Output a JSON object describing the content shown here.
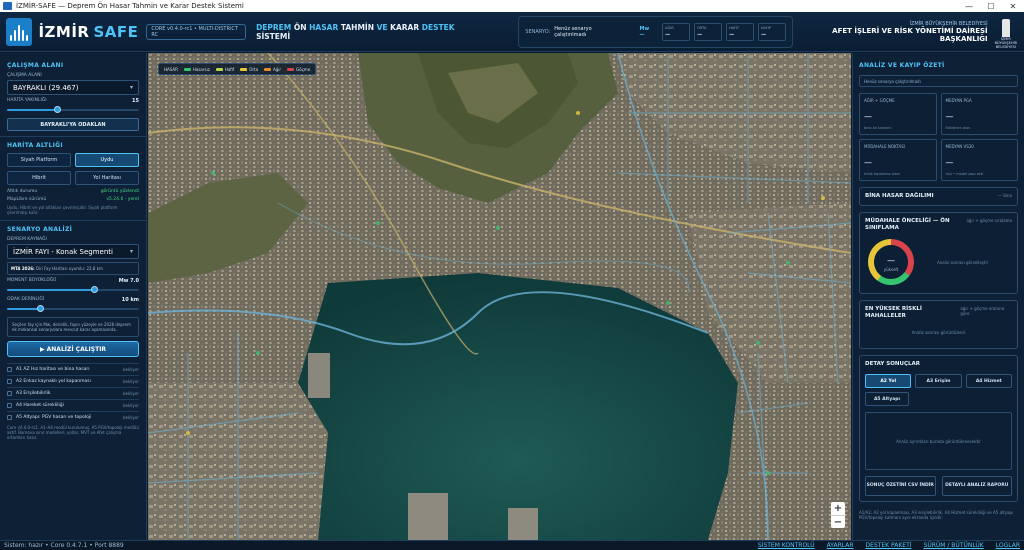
{
  "window": {
    "title": "İZMİR-SAFE — Deprem Ön Hasar Tahmin ve Karar Destek Sistemi",
    "minimize": "—",
    "maximize": "☐",
    "close": "✕"
  },
  "header": {
    "brand": "İZMİR",
    "brand_accent": "SAFE",
    "version_badge": "CORE v0.4.0-rc1 • MULTI-DISTRICT RC",
    "title_parts": [
      "DEPREM ",
      "ÖN ",
      "HASAR ",
      "TAHMİN ",
      "VE ",
      "KARAR ",
      "DESTEK ",
      "SİSTEMİ"
    ],
    "scenario_label": "SENARYO:",
    "scenario_value": "Henüz senaryo çalıştırılmadı",
    "mw_label": "Mw —",
    "chips": [
      {
        "label": "AĞIR",
        "value": "—"
      },
      {
        "label": "ORTA",
        "value": "—"
      },
      {
        "label": "HAFİF",
        "value": "—"
      },
      {
        "label": "KAYIP",
        "value": "—"
      }
    ],
    "org_line1": "İZMİR BÜYÜKŞEHİR BELEDİYESİ",
    "org_line2": "AFET İŞLERİ VE RİSK YÖNETİMİ DAİRESİ BAŞKANLIĞI",
    "emblem_text": "İZMİR BÜYÜKŞEHİR BELEDİYESİ"
  },
  "left": {
    "work_area_title": "ÇALIŞMA ALANI",
    "work_area_label": "ÇALIŞMA ALANI",
    "work_area_value": "BAYRAKLI (29.467)",
    "zoom_label": "HARİTA YAKINLIĞI",
    "zoom_value": "15",
    "zoom_fraction": 0.38,
    "focus_button": "BAYRAKLI'YA ODAKLAN",
    "map_layer_title": "HARİTA ALTLIĞI",
    "layer_buttons": [
      "Siyah Platform",
      "Uydu",
      "Hibrit",
      "Yol Haritası"
    ],
    "active_layer": "Uydu",
    "kv": [
      {
        "k": "Altlık durumu",
        "v": "görüntü yüklendi",
        "green": true
      },
      {
        "k": "MapLibre sürümü",
        "v": "v5.24.0 - yerel",
        "green": true
      }
    ],
    "layer_note": "Uydu, Hibrit ve yol altlıkları çevrimiçidir. Siyah platform çevrimdışı kalır.",
    "scenario_title": "SENARYO ANALİZİ",
    "fault_label": "DEPREM KAYNAĞI",
    "fault_value": "İZMİR FAYI - Konak Segmenti",
    "mta_label": "MTA 2026:",
    "mta_text": "Diri Fay Haritası uyumlu: 22,8 km",
    "magnitude_label": "MOMENT BÜYÜKLÜĞÜ",
    "magnitude_value": "Mw 7.0",
    "magnitude_fraction": 0.66,
    "depth_label": "ODAK DERİNLİĞİ",
    "depth_value": "10 km",
    "depth_fraction": 0.25,
    "info_text": "Seçilen fay için Mw, derinlik, fayın yüzeyle ve 2026 deprem ek mekansal senaryolara mevcut karar aşamasında.",
    "run_button": "▶ ANALİZİ ÇALIŞTIR",
    "analysis_items": [
      {
        "label": "A1 AZ Hız haritası ve bina hasarı",
        "status": "bekliyor"
      },
      {
        "label": "A2 Enkaz kaynaklı yol kapanması",
        "status": "bekliyor"
      },
      {
        "label": "A3 Erişilebilirlik",
        "status": "bekliyor"
      },
      {
        "label": "A4 Hareket sürekliliği",
        "status": "bekliyor"
      },
      {
        "label": "A5 Altyapı: PGV hasarı ve topoloji",
        "status": "bekliyor"
      }
    ],
    "footer_note": "Core v0.4.0-rc1. A1–A4 modül kurulumuş. A5 PGV/topoloji modülü aktif. Bornova sınır modelleri, yollar, MVT ve Afet çalışma ortamları hazır."
  },
  "map": {
    "legend_title": "HASAR",
    "legend": [
      {
        "label": "Hasarsız",
        "color": "#37c46f"
      },
      {
        "label": "Hafif",
        "color": "#b6d84a"
      },
      {
        "label": "Orta",
        "color": "#e8c43a"
      },
      {
        "label": "Ağır",
        "color": "#e98a2e"
      },
      {
        "label": "Göçme",
        "color": "#d9434c"
      }
    ],
    "zoom_in": "+",
    "zoom_out": "−"
  },
  "right": {
    "title": "ANALİZ VE KAYIP ÖZETİ",
    "placeholder": "Henüz senaryo çalıştırılmadı",
    "cards": [
      {
        "title": "AĞIR + GÖÇME",
        "value": "—",
        "sub": "bina ön tahmini"
      },
      {
        "title": "MEDYAN PGA",
        "value": "—",
        "sub": "Etkilenen alan"
      },
      {
        "title": "MÜDAHALE NOKTASI",
        "value": "—",
        "sub": "kritik toplanma alanı"
      },
      {
        "title": "MEDYAN VS30",
        "value": "—",
        "sub": "m/s • model yapı seti"
      }
    ],
    "damage_title": "BİNA HASAR DAĞILIMI",
    "damage_note": "— bina",
    "priority_title": "MÜDAHALE ÖNCELİĞİ — ÖN SINIFLAMA",
    "priority_note": "ağır + göçme sıralama",
    "donut_value": "—",
    "donut_sub": "yükselt",
    "donut_note": "Analiz sonrası görselleştir",
    "donut_segments": [
      {
        "value": 35,
        "color": "#d9434c"
      },
      {
        "value": 25,
        "color": "#37c46f"
      },
      {
        "value": 40,
        "color": "#e8c43a"
      }
    ],
    "risk_title": "EN YÜKSEK RİSKLİ MAHALLELER",
    "risk_note": "ağır + göçme oranına göre",
    "risk_empty": "Analiz sonrası görüntülenir",
    "detail_title": "DETAY SONUÇLAR",
    "detail_tabs": [
      "A2 Yol",
      "A3 Erişim",
      "A4 Hizmet",
      "A5 Altyapı"
    ],
    "active_tab": "A2 Yol",
    "result_empty": "Analiz ayrıntıları burada görüntülenecektir",
    "summary_button": "SONUÇ ÖZETİNİ CSV İNDİR",
    "report_button": "DETAYLI ANALİZ RAPORU",
    "footer_note": "A1/A2, A2 yol kapanması, A3 erişilebilirlik, A4 Hizmet sürekliliği ve A5 altyapı PGV/topoloji katmanı aynı ekranda içindir."
  },
  "status": {
    "left": "Sistem: hazır • Core 0.4.7.1 • Port 8889",
    "links": [
      "SİSTEM KONTROLÜ",
      "AYARLAR",
      "DESTEK PAKETİ",
      "SÜRÜM / BÜTÜNLÜK",
      "LOGLAR"
    ]
  }
}
